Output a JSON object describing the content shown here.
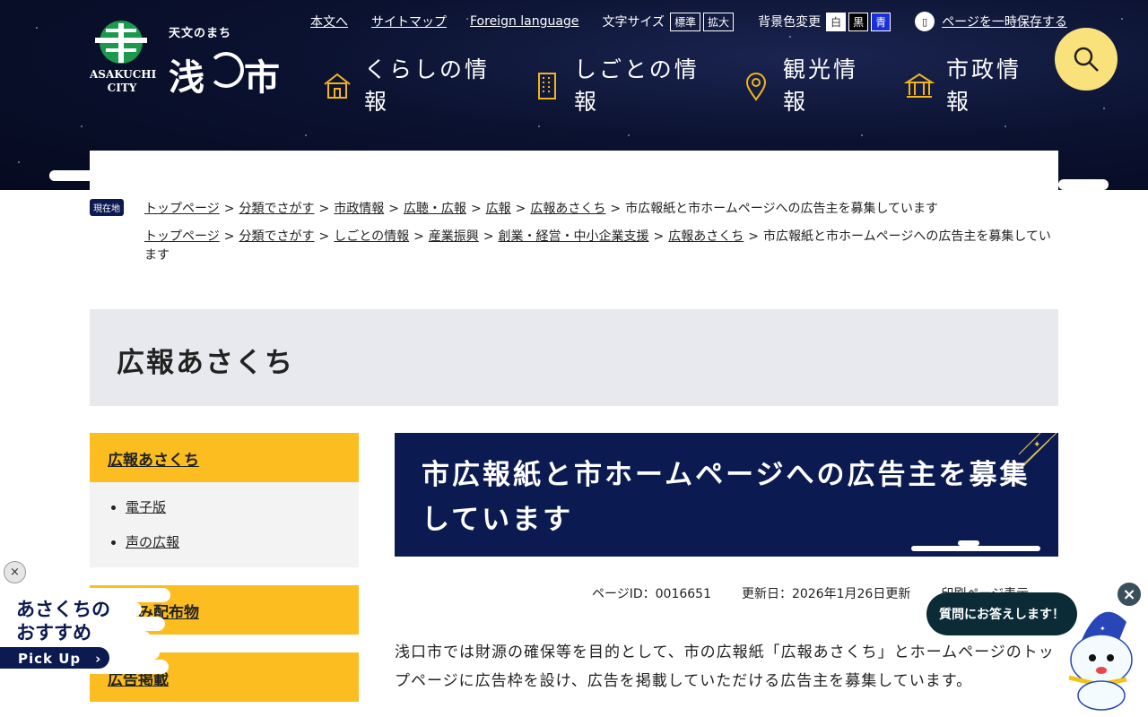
{
  "logo": {
    "tagline": "天文のまち",
    "name": "浅　市",
    "en_line1": "ASAKUCHI",
    "en_line2": "CITY",
    "colors": {
      "mark": "#1a9a4a"
    }
  },
  "util": {
    "skip": "本文へ",
    "sitemap": "サイトマップ",
    "foreign": "Foreign language",
    "font_size_label": "文字サイズ",
    "font_std": "標準",
    "font_large": "拡大",
    "bg_label": "背景色変更",
    "bg_white": "白",
    "bg_black": "黒",
    "bg_blue": "青",
    "save": "ページを一時保存する"
  },
  "gnav": [
    {
      "label": "くらしの情報",
      "icon": "house-icon"
    },
    {
      "label": "しごとの情報",
      "icon": "building-icon"
    },
    {
      "label": "観光情報",
      "icon": "map-pin-icon"
    },
    {
      "label": "市政情報",
      "icon": "city-hall-icon"
    }
  ],
  "breadcrumb": {
    "here_label": "現在地",
    "trail1": [
      "トップページ",
      "分類でさがす",
      "市政情報",
      "広聴・広報",
      "広報",
      "広報あさくち"
    ],
    "trail1_current": "市広報紙と市ホームページへの広告主を募集しています",
    "trail2": [
      "トップページ",
      "分類でさがす",
      "しごとの情報",
      "産業振興",
      "創業・経営・中小企業支援",
      "広報あさくち"
    ],
    "trail2_current": "市広報紙と市ホームページへの広告主を募集しています",
    "sep": ">"
  },
  "page_title": "広報あさくち",
  "side": {
    "head": "広報あさくち",
    "items": [
      "電子版",
      "声の広報"
    ],
    "sec1": "折込み配布物",
    "sec2": "広告掲載"
  },
  "main": {
    "title": "市広報紙と市ホームページへの広告主を募集しています",
    "page_id": "ページID：0016651",
    "updated": "更新日：2026年1月26日更新",
    "print": "印刷ページ表示",
    "body": "浅口市では財源の確保等を目的として、市の広報紙「広報あさくち」とホームページのトップページに広告枠を設け、広告を掲載していただける広告主を募集しています。"
  },
  "pickup": {
    "line1": "あさくちの",
    "line2": "おすすめ",
    "button": "Pick Up　›",
    "close": "×"
  },
  "chat": {
    "bubble": "質問にお答えします！",
    "close": "×"
  },
  "colors": {
    "navy": "#0b1a50",
    "yellow": "#fbbd1f",
    "gray_band": "#e8e9ef",
    "search": "#f9e27c"
  }
}
